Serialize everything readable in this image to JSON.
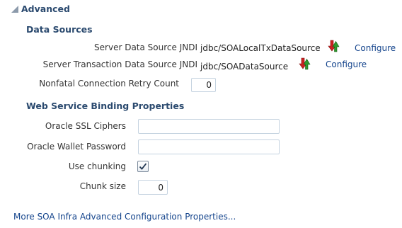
{
  "section": {
    "title": "Advanced"
  },
  "data_sources": {
    "heading": "Data Sources",
    "server_ds_jndi": {
      "label": "Server Data Source JNDI",
      "value": "jdbc/SOALocalTxDataSource",
      "configure_label": "Configure"
    },
    "server_tx_ds_jndi": {
      "label": "Server Transaction Data Source JNDI",
      "value": "jdbc/SOADataSource",
      "configure_label": "Configure"
    },
    "retry_count": {
      "label": "Nonfatal Connection Retry Count",
      "value": "0"
    }
  },
  "ws_binding": {
    "heading": "Web Service Binding Properties",
    "ssl_ciphers": {
      "label": "Oracle SSL Ciphers",
      "value": ""
    },
    "wallet_password": {
      "label": "Oracle Wallet Password",
      "value": ""
    },
    "use_chunking": {
      "label": "Use chunking",
      "checked": true
    },
    "chunk_size": {
      "label": "Chunk size",
      "value": "0"
    }
  },
  "more_link": "More SOA Infra Advanced Configuration Properties...",
  "colors": {
    "heading": "#2b4a6f",
    "link": "#14448c",
    "input_border": "#c5d3e0",
    "icon_red": "#cc2222",
    "icon_green": "#2e9a2e"
  },
  "icons": {
    "collapse": "triangle-expanded-icon",
    "test_connection": "red-green-arrows-icon",
    "checkbox": "check-mark-icon"
  }
}
